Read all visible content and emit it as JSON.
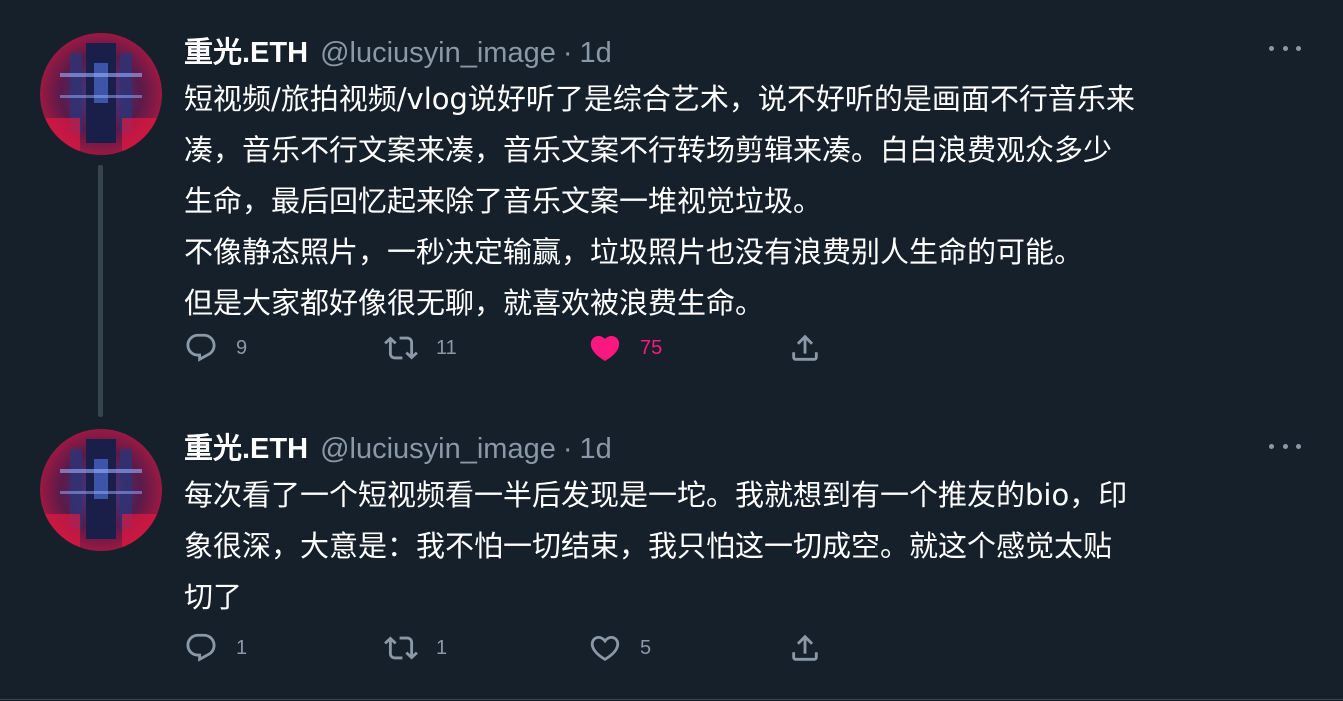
{
  "tweets": [
    {
      "display_name": "重光.ETH",
      "handle": "@luciusyin_image",
      "separator": "·",
      "time": "1d",
      "text_lines": [
        "短视频/旅拍视频/vlog说好听了是综合艺术，说不好听的是画面不行音乐来",
        "凑，音乐不行文案来凑，音乐文案不行转场剪辑来凑。白白浪费观众多少",
        "生命，最后回忆起来除了音乐文案一堆视觉垃圾。",
        "不像静态照片，一秒决定输赢，垃圾照片也没有浪费别人生命的可能。",
        "但是大家都好像很无聊，就喜欢被浪费生命。"
      ],
      "replies": "9",
      "retweets": "11",
      "likes": "75",
      "liked": true
    },
    {
      "display_name": "重光.ETH",
      "handle": "@luciusyin_image",
      "separator": "·",
      "time": "1d",
      "text_lines": [
        "每次看了一个短视频看一半后发现是一坨。我就想到有一个推友的bio，印",
        "象很深，大意是：我不怕一切结束，我只怕这一切成空。就这个感觉太贴",
        "切了"
      ],
      "replies": "1",
      "retweets": "1",
      "likes": "5",
      "liked": false
    }
  ],
  "icons": {
    "reply": "reply-icon",
    "retweet": "retweet-icon",
    "like": "heart-icon",
    "share": "share-icon",
    "more": "more-icon"
  },
  "colors": {
    "background": "#15202b",
    "text": "#ffffff",
    "secondary": "#8b98a5",
    "like": "#f91880",
    "divider": "#38444d"
  }
}
